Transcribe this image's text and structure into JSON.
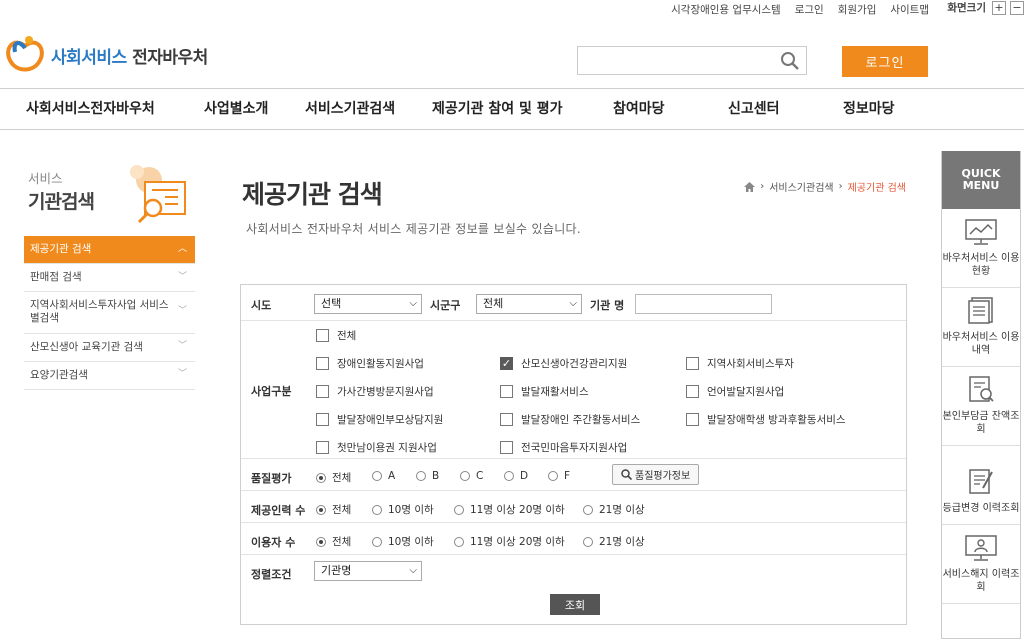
{
  "util": {
    "links": [
      "시각장애인용 업무시스템",
      "로그인",
      "회원가입",
      "사이트맵"
    ],
    "font_size_label": "화면크기",
    "plus": "+",
    "minus": "−"
  },
  "header": {
    "logo_part1": "사회서비스",
    "logo_part2": " 전자바우처",
    "search_placeholder": "",
    "login_button": "로그인"
  },
  "gnb": [
    "사회서비스전자바우처",
    "사업별소개",
    "서비스기관검색",
    "제공기관 참여 및 평가",
    "참여마당",
    "신고센터",
    "정보마당"
  ],
  "lnb": {
    "title_small": "서비스",
    "title_big": "기관검색",
    "items": [
      {
        "label": "제공기관 검색"
      },
      {
        "label": "판매점 검색"
      },
      {
        "label": "지역사회서비스투자사업 서비스별검색"
      },
      {
        "label": "산모신생아 교육기관 검색"
      },
      {
        "label": "요양기관검색"
      }
    ]
  },
  "page": {
    "title": "제공기관 검색",
    "description": "사회서비스 전자바우처 서비스 제공기관 정보를 보실수 있습니다.",
    "breadcrumb": [
      "서비스기관검색",
      "제공기관 검색"
    ]
  },
  "form": {
    "sido_label": "시도",
    "sido_value": "선택",
    "sigungu_label": "시군구",
    "sigungu_value": "전체",
    "org_label": "기관 명",
    "org_value": "",
    "biz_label": "사업구분",
    "biz_options": [
      {
        "label": "전체",
        "checked": false
      },
      {
        "label": "장애인활동지원사업",
        "checked": false
      },
      {
        "label": "산모신생아건강관리지원",
        "checked": true
      },
      {
        "label": "지역사회서비스투자",
        "checked": false
      },
      {
        "label": "가사간병방문지원사업",
        "checked": false
      },
      {
        "label": "발달재활서비스",
        "checked": false
      },
      {
        "label": "언어발달지원사업",
        "checked": false
      },
      {
        "label": "발달장애인부모상담지원",
        "checked": false
      },
      {
        "label": "발달장애인 주간활동서비스",
        "checked": false
      },
      {
        "label": "발달장애학생 방과후활동서비스",
        "checked": false
      },
      {
        "label": "첫만남이용권 지원사업",
        "checked": false
      },
      {
        "label": "전국민마음투자지원사업",
        "checked": false
      }
    ],
    "quality_label": "품질평가",
    "quality_options": [
      "전체",
      "A",
      "B",
      "C",
      "D",
      "F"
    ],
    "quality_selected": "전체",
    "quality_info_button": "품질평가정보",
    "staff_label": "제공인력 수",
    "staff_options": [
      "전체",
      "10명 이하",
      "11명 이상 20명 이하",
      "21명 이상"
    ],
    "staff_selected": "전체",
    "users_label": "이용자 수",
    "users_options": [
      "전체",
      "10명 이하",
      "11명 이상 20명 이하",
      "21명 이상"
    ],
    "users_selected": "전체",
    "sort_label": "정렬조건",
    "sort_value": "기관명",
    "submit": "조회"
  },
  "quick": {
    "title": "QUICK MENU",
    "items": [
      {
        "label": "바우처서비스 이용현황",
        "icon": "monitor-chart-icon"
      },
      {
        "label": "바우처서비스 이용내역",
        "icon": "document-list-icon"
      },
      {
        "label": "본인부담금 잔액조회",
        "icon": "document-search-icon"
      },
      {
        "label": "등급변경 이력조회",
        "icon": "document-edit-icon"
      },
      {
        "label": "서비스해지 이력조회",
        "icon": "monitor-user-icon"
      }
    ]
  },
  "colors": {
    "accent": "#f08a1c",
    "brand_blue": "#2b7bc4",
    "breadcrumb_current": "#e45a3a"
  }
}
